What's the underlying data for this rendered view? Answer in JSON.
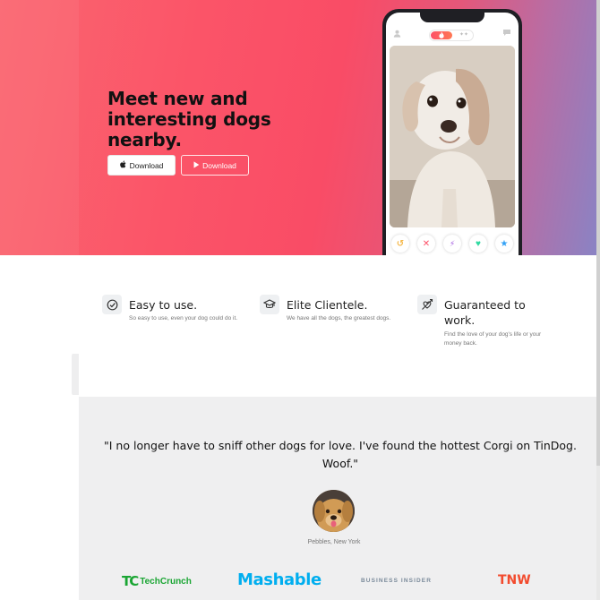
{
  "hero": {
    "title": "Meet new and interesting dogs nearby.",
    "apple_button": "Download",
    "play_button": "Download",
    "apple_icon": "apple-icon",
    "play_icon": "play-store-icon",
    "gradient_colors": [
      "#fa6670",
      "#f94c66",
      "#8a83c4"
    ]
  },
  "phone": {
    "toggle_icon": "flame-icon",
    "action_icons": [
      "undo-icon",
      "nope-icon",
      "boost-icon",
      "like-icon",
      "superlike-icon"
    ],
    "action_colors": [
      "#f5b748",
      "#fd5068",
      "#a35de0",
      "#2dd9a0",
      "#32a1f6"
    ]
  },
  "features": [
    {
      "icon": "check-circle-icon",
      "title": "Easy to use.",
      "desc": "So easy to use, even your dog could do it."
    },
    {
      "icon": "graduation-cap-icon",
      "title": "Elite Clientele.",
      "desc": "We have all the dogs, the greatest dogs."
    },
    {
      "icon": "heart-arrow-icon",
      "title": "Guaranteed to work.",
      "desc": "Find the love of your dog's life or your money back."
    }
  ],
  "testimonial": {
    "quote": "\"I no longer have to sniff other dogs for love. I've found the hottest Corgi on TinDog. Woof.\"",
    "author": "Pebbles, New York"
  },
  "press": {
    "techcrunch": "TechCrunch",
    "techcrunch_mark": "TC",
    "mashable": "Mashable",
    "business_insider": "BUSINESS INSIDER",
    "tnw": "TNW"
  }
}
